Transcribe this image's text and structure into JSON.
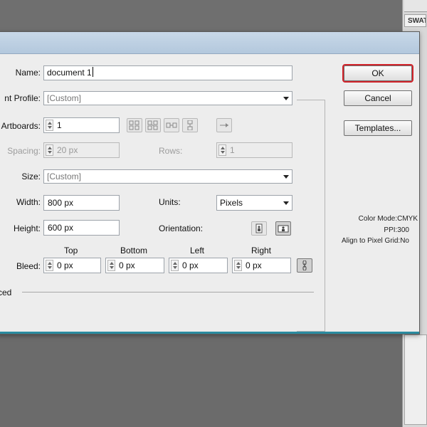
{
  "right_panel": {
    "tab_label": "SWAT"
  },
  "dialog": {
    "name_label": "Name:",
    "name_value": "document 1",
    "profile_label": "nt Profile:",
    "profile_value": "[Custom]",
    "artboards_label": "Artboards:",
    "artboards_value": "1",
    "spacing_label": "Spacing:",
    "spacing_value": "20 px",
    "rows_label": "Rows:",
    "rows_value": "1",
    "size_label": "Size:",
    "size_value": "[Custom]",
    "width_label": "Width:",
    "width_value": "800 px",
    "units_label": "Units:",
    "units_value": "Pixels",
    "height_label": "Height:",
    "height_value": "600 px",
    "orientation_label": "Orientation:",
    "bleed_label": "Bleed:",
    "bleed_top_label": "Top",
    "bleed_top_value": "0 px",
    "bleed_bottom_label": "Bottom",
    "bleed_bottom_value": "0 px",
    "bleed_left_label": "Left",
    "bleed_left_value": "0 px",
    "bleed_right_label": "Right",
    "bleed_right_value": "0 px",
    "advanced_label": "ced",
    "ok_label": "OK",
    "cancel_label": "Cancel",
    "templates_label": "Templates...",
    "color_mode": "Color Mode:CMYK",
    "ppi": "PPI:300",
    "align_grid": "Align to Pixel Grid:No"
  },
  "colors": {
    "ok_highlight": "#d2232a",
    "titlebar": "#b3c8dd",
    "dialog_bg": "#ededed",
    "bottom_accent": "#2a8ba0"
  },
  "icons": [
    "spinner-arrows-icon",
    "grid-by-row-icon",
    "grid-by-column-icon",
    "arrange-by-row-icon",
    "arrange-by-column-icon",
    "right-to-left-arrow-icon",
    "portrait-orientation-icon",
    "landscape-orientation-icon",
    "link-bleed-icon",
    "dropdown-arrow-icon"
  ]
}
